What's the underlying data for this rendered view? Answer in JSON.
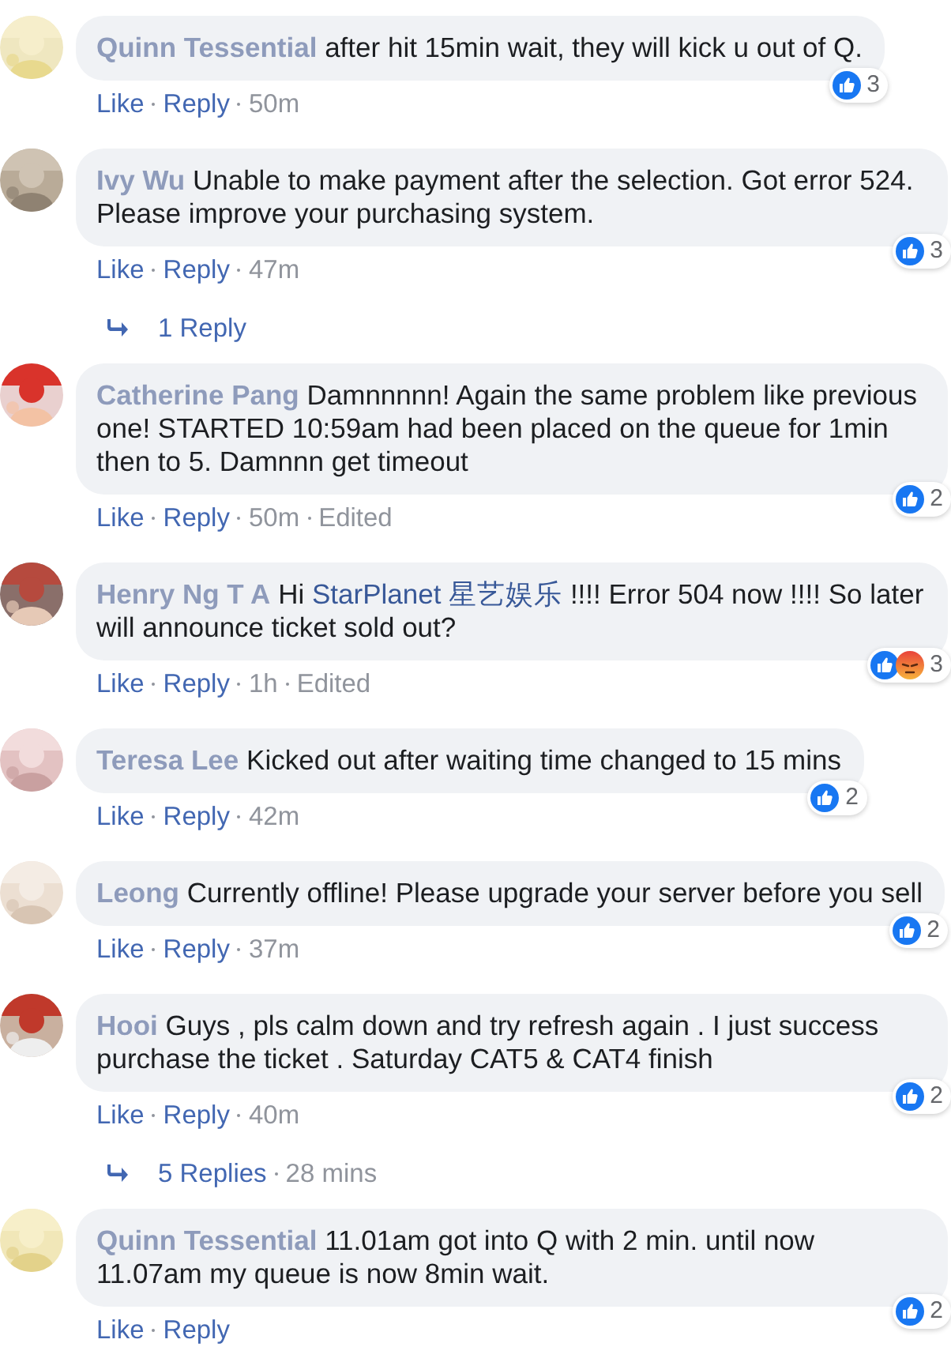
{
  "comments": [
    {
      "author": "Quinn Tessential",
      "parts": [
        {
          "kind": "text",
          "text": "after hit 15min wait, they will kick u out of Q."
        }
      ],
      "reactions": {
        "icons": [
          {
            "kind": "like"
          }
        ],
        "count": "3"
      },
      "actions": [
        "Like",
        "Reply"
      ],
      "time": "50m"
    },
    {
      "author": "Ivy Wu",
      "parts": [
        {
          "kind": "text",
          "text": "Unable to make payment after the selection. Got error 524. Please improve your purchasing system."
        }
      ],
      "reactions": {
        "icons": [
          {
            "kind": "like"
          }
        ],
        "count": "3"
      },
      "actions": [
        "Like",
        "Reply"
      ],
      "time": "47m",
      "replies": {
        "label": "1 Reply"
      }
    },
    {
      "author": "Catherine Pang",
      "parts": [
        {
          "kind": "text",
          "text": "Damnnnnn! Again the same problem like previous one! STARTED 10:59am had been placed on the queue for 1min then to 5. Damnnn get timeout"
        }
      ],
      "reactions": {
        "icons": [
          {
            "kind": "like"
          }
        ],
        "count": "2"
      },
      "actions": [
        "Like",
        "Reply"
      ],
      "time": "50m",
      "edited": "Edited"
    },
    {
      "author": "Henry Ng T A",
      "parts": [
        {
          "kind": "text",
          "text": "Hi"
        },
        {
          "kind": "mention",
          "text": "StarPlanet 星艺娱乐"
        },
        {
          "kind": "text",
          "text": "!!!! Error 504 now !!!! So later will announce ticket sold out?"
        }
      ],
      "reactions": {
        "icons": [
          {
            "kind": "like"
          },
          {
            "kind": "angry"
          }
        ],
        "count": "3"
      },
      "actions": [
        "Like",
        "Reply"
      ],
      "time": "1h",
      "edited": "Edited"
    },
    {
      "author": "Teresa Lee",
      "parts": [
        {
          "kind": "text",
          "text": "Kicked out after waiting time changed to 15 mins"
        }
      ],
      "reactions": {
        "icons": [
          {
            "kind": "like"
          }
        ],
        "count": "2"
      },
      "actions": [
        "Like",
        "Reply"
      ],
      "time": "42m"
    },
    {
      "author": "Leong",
      "parts": [
        {
          "kind": "text",
          "text": "Currently offline! Please upgrade your server before you sell"
        }
      ],
      "reactions": {
        "icons": [
          {
            "kind": "like"
          }
        ],
        "count": "2"
      },
      "actions": [
        "Like",
        "Reply"
      ],
      "time": "37m"
    },
    {
      "author": "Hooi",
      "parts": [
        {
          "kind": "text",
          "text": "Guys , pls calm down and try refresh again . I just success purchase the ticket . Saturday CAT5 & CAT4 finish"
        }
      ],
      "reactions": {
        "icons": [
          {
            "kind": "like"
          }
        ],
        "count": "2"
      },
      "actions": [
        "Like",
        "Reply"
      ],
      "time": "40m",
      "replies": {
        "label": "5 Replies",
        "time": "28 mins"
      }
    },
    {
      "author": "Quinn Tessential",
      "parts": [
        {
          "kind": "text",
          "text": "11.01am got into Q with 2 min. until now 11.07am my queue is now 8min wait."
        }
      ],
      "reactions": {
        "icons": [
          {
            "kind": "like"
          }
        ],
        "count": "2"
      },
      "actions": [
        "Like",
        "Reply"
      ]
    }
  ]
}
